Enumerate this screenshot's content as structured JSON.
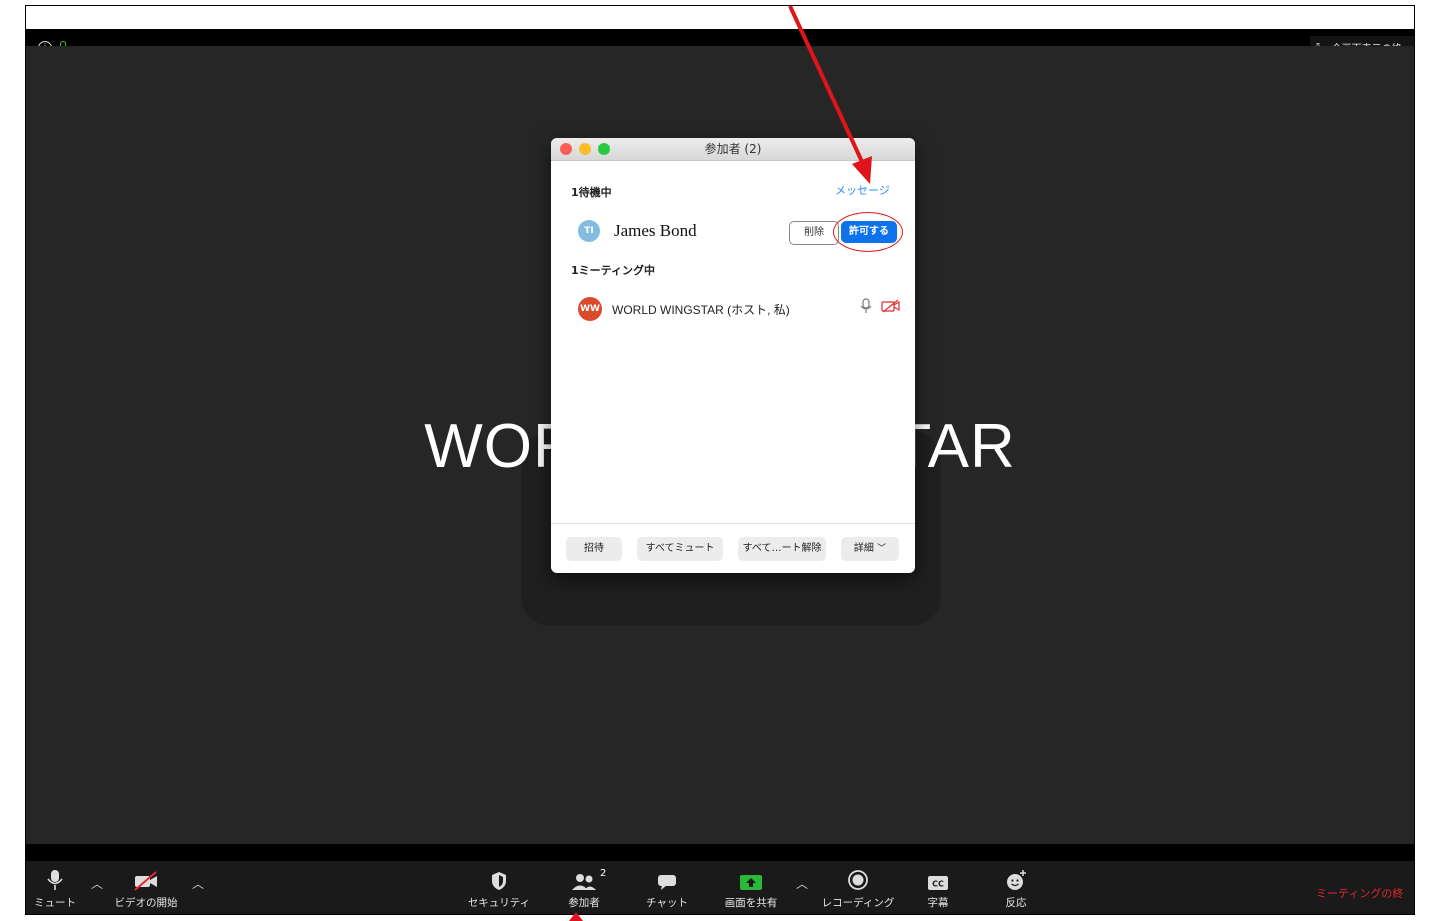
{
  "meeting": {
    "big_name": "WORLD WINGSTAR",
    "fullscreen_exit_label": "全画面表示の終"
  },
  "panel": {
    "title": "参加者 (2)",
    "waiting_label": "1待機中",
    "message_link": "メッセージ",
    "waiting_participant": {
      "initials": "TI",
      "name": "James Bond"
    },
    "remove_label": "削除",
    "admit_label": "許可する",
    "in_meeting_label": "1ミーティング中",
    "host_participant": {
      "initials": "WW",
      "name": "WORLD WINGSTAR (ホスト, 私)"
    },
    "footer": {
      "invite": "招待",
      "mute_all": "すべてミュート",
      "unmute_all": "すべて…ート解除",
      "more": "詳細"
    }
  },
  "toolbar": {
    "mute": "ミュート",
    "start_video": "ビデオの開始",
    "security": "セキュリティ",
    "participants": "参加者",
    "participants_count": "2",
    "chat": "チャット",
    "share_screen": "画面を共有",
    "record": "レコーディング",
    "captions": "字幕",
    "reactions": "反応",
    "end_meeting": "ミーティングの終"
  },
  "colors": {
    "admit_button": "#0e72ed",
    "annotation_red": "#e0141b",
    "end_meeting": "#e0282e",
    "share_green": "#29b838"
  }
}
